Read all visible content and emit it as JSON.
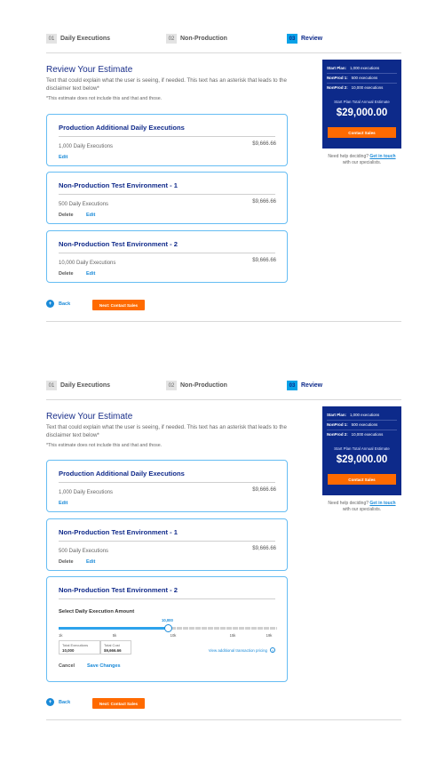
{
  "steps": [
    {
      "num": "01",
      "label": "Daily Executions"
    },
    {
      "num": "02",
      "label": "Non-Production"
    },
    {
      "num": "03",
      "label": "Review"
    }
  ],
  "page": {
    "title": "Review Your Estimate",
    "description": "Text that could explain what the user is seeing, if needed. This text has an asterisk that leads to the disclaimer text below*",
    "disclaimer": "*This estimate does not include this and that and those."
  },
  "cards": [
    {
      "title": "Production Additional Daily Executions",
      "desc": "1,000 Daily Executions",
      "price": "$9,666.66",
      "edit": "Edit"
    },
    {
      "title": "Non-Production Test Environment - 1",
      "desc": "500 Daily Executions",
      "price": "$9,666.66",
      "delete": "Delete",
      "edit": "Edit"
    },
    {
      "title": "Non-Production Test Environment - 2",
      "desc": "10,000 Daily Executions",
      "price": "$9,666.66",
      "delete": "Delete",
      "edit": "Edit"
    }
  ],
  "editor": {
    "label": "Select Daily Execution Amount",
    "value_tag": "10,000",
    "value_fraction": 0.5,
    "ticks": [
      "1k",
      "5k",
      "10k",
      "15k",
      "19k"
    ],
    "total_executions_label": "Total Executions",
    "total_executions": "10,000",
    "total_cost_label": "Total Cost",
    "total_cost": "$9,666.66",
    "view_link": "View additional transaction pricing",
    "info_icon": "info-icon",
    "cancel": "Cancel",
    "save": "Save Changes"
  },
  "summary": {
    "rows": [
      {
        "label": "Start Plan:",
        "value": "1,000 executions"
      },
      {
        "label": "NonProd 1:",
        "value": "500 executions"
      },
      {
        "label": "NonProd 2:",
        "value": "10,000 executions"
      }
    ],
    "total_label": "Start Plan Total Annual Estimate",
    "total": "$29,000.00",
    "contact_button": "Contact Sales",
    "help_prefix": "Need help deciding?",
    "help_link": "Get in touch",
    "help_suffix": "with our specialists."
  },
  "nav": {
    "back": "Back",
    "back_icon": "+",
    "next": "Next: Contact Sales"
  },
  "colors": {
    "brand_navy": "#0d2a8a",
    "accent_blue": "#1a8ad8",
    "cta_orange": "#ff6a00",
    "card_border": "#66bdf3"
  }
}
